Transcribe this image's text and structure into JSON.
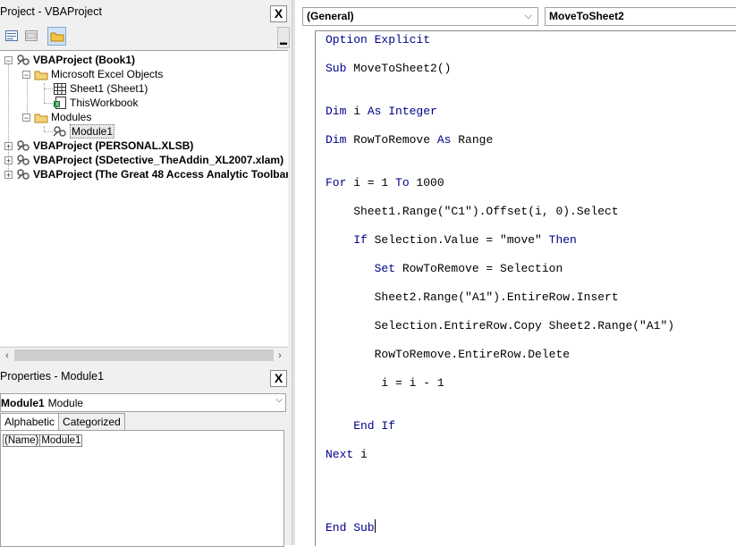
{
  "project": {
    "title": "Project - VBAProject",
    "close": "X",
    "tree": [
      {
        "label": "VBAProject (Book1)",
        "bold": true
      },
      {
        "label": "Microsoft Excel Objects"
      },
      {
        "label": "Sheet1 (Sheet1)"
      },
      {
        "label": "ThisWorkbook"
      },
      {
        "label": "Modules"
      },
      {
        "label": "Module1"
      },
      {
        "label": "VBAProject (PERSONAL.XLSB)",
        "bold": true
      },
      {
        "label": "VBAProject (SDetective_TheAddin_XL2007.xlam)",
        "bold": true
      },
      {
        "label": "VBAProject (The Great 48 Access Analytic Toolbar",
        "bold": true
      }
    ],
    "scroll_left": "‹",
    "scroll_right": "›"
  },
  "properties": {
    "title": "Properties - Module1",
    "close": "X",
    "object_name": "Module1",
    "object_type": "Module",
    "tabs": [
      "Alphabetic",
      "Categorized"
    ],
    "rows": [
      {
        "name": "(Name)",
        "value": "Module1"
      }
    ]
  },
  "code_window": {
    "object_combo": "(General)",
    "proc_combo": "MoveToSheet2",
    "lines": [
      {
        "kw": "Option Explicit",
        "rest": ""
      },
      {
        "kw": "Sub",
        "rest": " MoveToSheet2()"
      },
      {
        "kw": "Dim",
        "rest": " i ",
        "kw2": "As Integer",
        "rest2": ""
      },
      {
        "kw": "Dim",
        "rest": " RowToRemove ",
        "kw2": "As",
        "rest2": " Range"
      },
      {
        "kw": "For",
        "rest": " i = 1 ",
        "kw2": "To",
        "rest2": " 1000"
      },
      {
        "kw": "",
        "rest": "    Sheet1.Range(\"C1\").Offset(i, 0).Select"
      },
      {
        "kw": "    If",
        "rest": " Selection.Value = \"move\" ",
        "kw2": "Then",
        "rest2": ""
      },
      {
        "kw": "       Set",
        "rest": " RowToRemove = Selection"
      },
      {
        "kw": "",
        "rest": "       Sheet2.Range(\"A1\").EntireRow.Insert"
      },
      {
        "kw": "",
        "rest": "       Selection.EntireRow.Copy Sheet2.Range(\"A1\")"
      },
      {
        "kw": "",
        "rest": "       RowToRemove.EntireRow.Delete"
      },
      {
        "kw": "",
        "rest": "        i = i - 1"
      },
      {
        "kw": "    End If",
        "rest": ""
      },
      {
        "kw": "Next",
        "rest": " i"
      },
      {
        "kw": "End Sub",
        "rest": ""
      }
    ]
  },
  "colors": {
    "keyword": "#00008b",
    "panel_bg": "#f0f0f0"
  },
  "icons": [
    "project-icon",
    "folder-icon",
    "sheet-icon",
    "workbook-icon",
    "module-icon",
    "view-code-icon",
    "view-object-icon",
    "toggle-folders-icon"
  ]
}
